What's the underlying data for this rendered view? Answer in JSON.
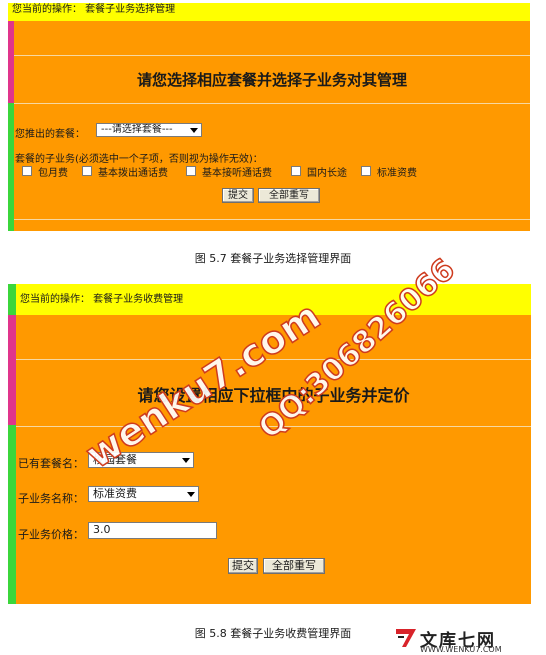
{
  "screenshot_1": {
    "current_op": "您当前的操作：  套餐子业务选择管理",
    "banner": "请您选择相应套餐并选择子业务对其管理",
    "package_label": "您推出的套餐：",
    "package_select": "---请选择套餐---",
    "sub_label": "套餐的子业务(必须选中一个子项，否则视为操作无效)：",
    "checkboxes": [
      "包月费",
      "基本拨出通话费",
      "基本接听通话费",
      "国内长途",
      "标准资费"
    ],
    "submit": "提交",
    "reset": "全部重写"
  },
  "caption_1": "图 5.7 套餐子业务选择管理界面",
  "screenshot_2": {
    "current_op": "您当前的操作：  套餐子业务收费管理",
    "banner": "请您设置相应下拉框中的子业务并定价",
    "fields": [
      {
        "label": "已有套餐名：",
        "value": "校园套餐"
      },
      {
        "label": "子业务名称：",
        "value": "标准资费"
      },
      {
        "label": "子业务价格：",
        "value": "3.0"
      }
    ],
    "submit": "提交",
    "reset": "全部重写"
  },
  "caption_2": "图 5.8  套餐子业务收费管理界面",
  "watermarks": [
    "wenku7.com",
    "QQ:306826066"
  ],
  "logo": {
    "name": "文库七网",
    "url": "WWW.WENKU7.COM"
  },
  "colors": {
    "panel": "#ff9900",
    "bar": "#ffff00",
    "left_stripe": "#3bd63b",
    "pink_stripe": "#e0358c",
    "watermark_outline": "#ce3b1e",
    "logo_red": "#d8232a"
  }
}
